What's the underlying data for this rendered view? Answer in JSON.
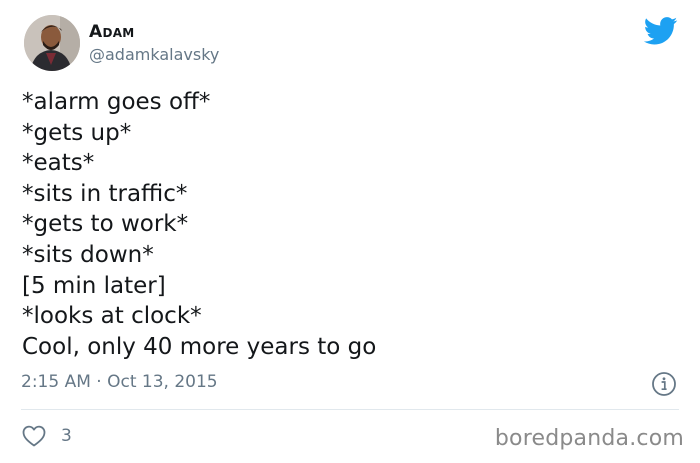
{
  "author": {
    "display_name": "Adam",
    "handle": "@adamkalavsky"
  },
  "tweet": {
    "lines": [
      "*alarm goes off*",
      "*gets up*",
      "*eats*",
      "*sits in traffic*",
      "*gets to work*",
      "*sits down*",
      "[5 min later]",
      "*looks at clock*",
      "Cool, only 40 more years to go"
    ],
    "time": "2:15 AM",
    "separator": "·",
    "date": "Oct 13, 2015"
  },
  "engagement": {
    "likes": "3"
  },
  "watermark": "boredpanda.com",
  "colors": {
    "twitter_blue": "#1da1f2",
    "secondary_text": "#657786",
    "primary_text": "#14171a"
  },
  "icons": {
    "brand": "twitter-bird-icon",
    "info": "info-icon",
    "like": "heart-icon"
  }
}
